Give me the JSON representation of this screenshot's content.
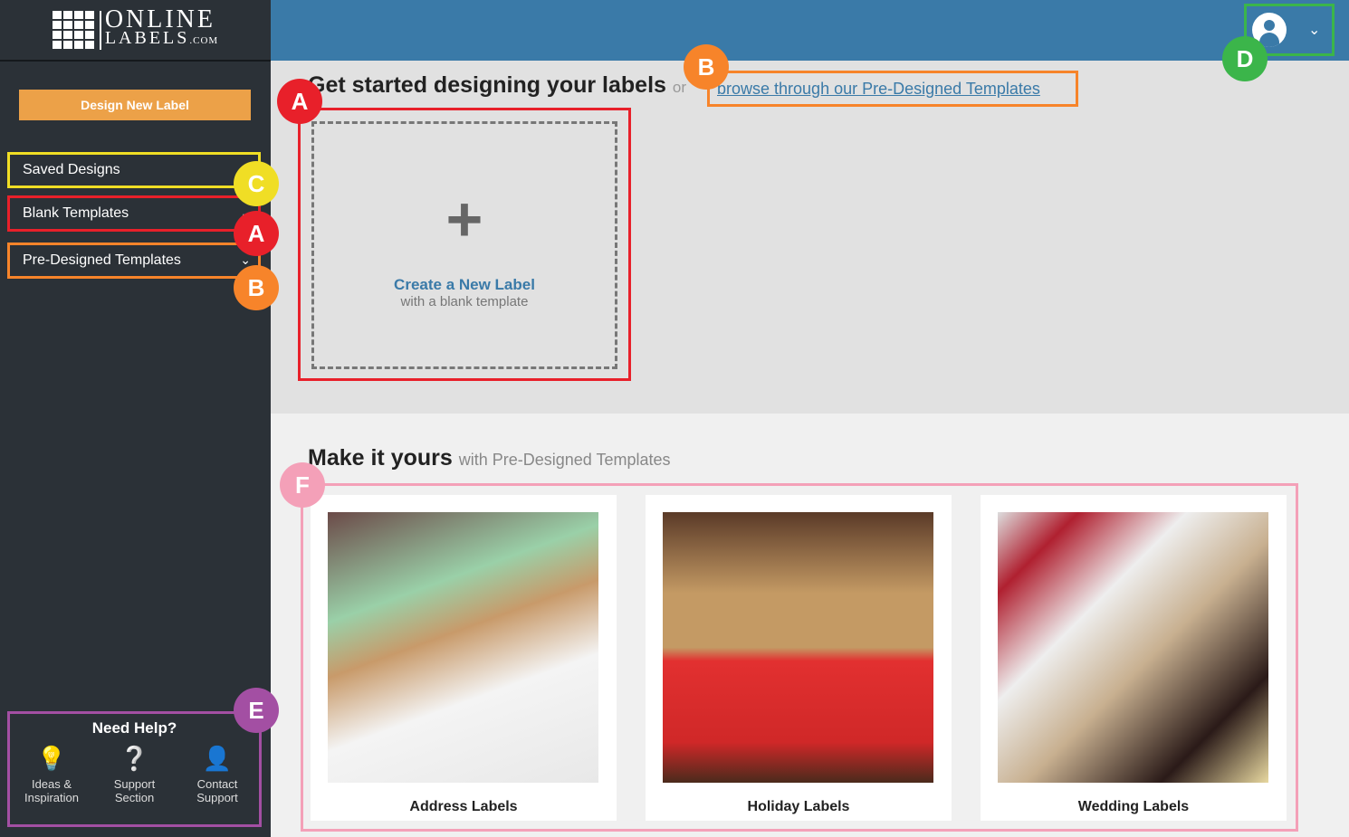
{
  "brand": {
    "line1": "ONLINE",
    "line2": "LABELS",
    "suffix": ".COM"
  },
  "sidebar": {
    "design_button": "Design New Label",
    "items": [
      {
        "label": "Saved Designs"
      },
      {
        "label": "Blank Templates"
      },
      {
        "label": "Pre-Designed Templates"
      }
    ]
  },
  "help": {
    "title": "Need Help?",
    "items": [
      {
        "line1": "Ideas &",
        "line2": "Inspiration",
        "icon": "lightbulb-icon"
      },
      {
        "line1": "Support",
        "line2": "Section",
        "icon": "question-icon"
      },
      {
        "line1": "Contact",
        "line2": "Support",
        "icon": "headset-icon"
      }
    ]
  },
  "main": {
    "title": "Get started designing your labels",
    "or": "or",
    "browse_link": "browse through our Pre-Designed Templates",
    "create_title": "Create a New Label",
    "create_sub": "with a blank template",
    "make_title": "Make it yours",
    "make_sub": "with Pre-Designed Templates",
    "cards": [
      {
        "label": "Address Labels"
      },
      {
        "label": "Holiday Labels"
      },
      {
        "label": "Wedding Labels"
      }
    ]
  },
  "badges": {
    "A": "A",
    "B": "B",
    "C": "C",
    "D": "D",
    "E": "E",
    "F": "F"
  },
  "colors": {
    "red": "#e8202a",
    "orange": "#f7842a",
    "yellow": "#f0de25",
    "green": "#3bb54a",
    "purple": "#a34fa3",
    "pink": "#f4a0b8",
    "header": "#3a7aa8",
    "sidebar": "#2b3137",
    "button": "#eca148"
  }
}
